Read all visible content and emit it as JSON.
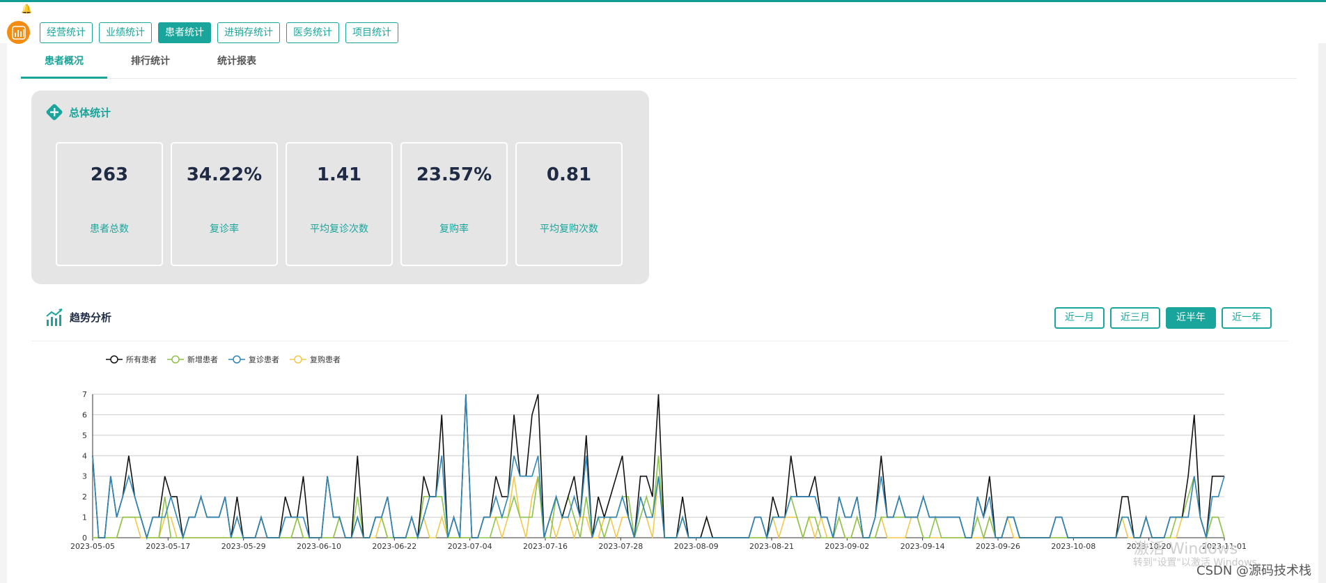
{
  "header": {
    "tabs": [
      "经营统计",
      "业绩统计",
      "患者统计",
      "进销存统计",
      "医务统计",
      "项目统计"
    ],
    "active_tab": 2
  },
  "subtabs": {
    "items": [
      "患者概况",
      "排行统计",
      "统计报表"
    ],
    "active": 0
  },
  "summary": {
    "title": "总体统计",
    "cards": [
      {
        "value": "263",
        "label": "患者总数"
      },
      {
        "value": "34.22%",
        "label": "复诊率"
      },
      {
        "value": "1.41",
        "label": "平均复诊次数"
      },
      {
        "value": "23.57%",
        "label": "复购率"
      },
      {
        "value": "0.81",
        "label": "平均复购次数"
      }
    ]
  },
  "trend": {
    "title": "趋势分析",
    "ranges": [
      "近一月",
      "近三月",
      "近半年",
      "近一年"
    ],
    "active_range": 2
  },
  "chart_data": {
    "type": "line",
    "ylim": [
      0,
      7
    ],
    "yticks": [
      0,
      1,
      2,
      3,
      4,
      5,
      6,
      7
    ],
    "xticks": [
      "2023-05-05",
      "2023-05-17",
      "2023-05-29",
      "2023-06-10",
      "2023-06-22",
      "2023-07-04",
      "2023-07-16",
      "2023-07-28",
      "2023-08-09",
      "2023-08-21",
      "2023-09-02",
      "2023-09-14",
      "2023-09-26",
      "2023-10-08",
      "2023-10-20",
      "2023-11-01"
    ],
    "legend_position": "top-left",
    "colors": [
      "#111111",
      "#8cc34a",
      "#2f86b5",
      "#f4c84a"
    ],
    "series": [
      {
        "name": "所有患者",
        "values": [
          4,
          0,
          0,
          3,
          1,
          2,
          4,
          2,
          1,
          0,
          1,
          1,
          3,
          2,
          2,
          0,
          1,
          1,
          2,
          1,
          1,
          1,
          2,
          0,
          2,
          0,
          0,
          0,
          1,
          0,
          0,
          0,
          2,
          1,
          1,
          3,
          0,
          0,
          0,
          3,
          1,
          1,
          0,
          0,
          4,
          0,
          0,
          1,
          1,
          2,
          0,
          0,
          0,
          1,
          0,
          3,
          2,
          2,
          6,
          0,
          1,
          0,
          7,
          0,
          0,
          1,
          1,
          3,
          2,
          2,
          6,
          3,
          3,
          6,
          7,
          0,
          1,
          2,
          1,
          2,
          3,
          1,
          5,
          0,
          2,
          1,
          2,
          3,
          4,
          1,
          0,
          3,
          3,
          2,
          7,
          0,
          0,
          0,
          2,
          0,
          0,
          0,
          1,
          0,
          0,
          0,
          0,
          0,
          0,
          0,
          1,
          1,
          0,
          2,
          1,
          1,
          4,
          2,
          2,
          2,
          3,
          1,
          1,
          0,
          2,
          1,
          1,
          2,
          0,
          0,
          1,
          4,
          1,
          1,
          2,
          1,
          1,
          1,
          2,
          1,
          1,
          1,
          1,
          1,
          1,
          0,
          0,
          2,
          1,
          3,
          0,
          0,
          1,
          1,
          0,
          0,
          0,
          0,
          0,
          0,
          1,
          1,
          0,
          0,
          0,
          0,
          0,
          0,
          0,
          0,
          0,
          2,
          2,
          0,
          0,
          1,
          0,
          0,
          0,
          1,
          1,
          1,
          3,
          6,
          1,
          0,
          3,
          3,
          3
        ]
      },
      {
        "name": "新增患者",
        "values": [
          0,
          0,
          0,
          0,
          0,
          1,
          1,
          1,
          1,
          0,
          0,
          0,
          2,
          0,
          0,
          0,
          0,
          0,
          0,
          0,
          0,
          0,
          0,
          0,
          0,
          0,
          0,
          0,
          1,
          0,
          0,
          0,
          0,
          0,
          1,
          0,
          0,
          0,
          0,
          0,
          0,
          1,
          0,
          0,
          2,
          0,
          0,
          1,
          1,
          0,
          0,
          0,
          0,
          0,
          0,
          2,
          2,
          2,
          2,
          0,
          0,
          0,
          0,
          0,
          0,
          0,
          0,
          1,
          1,
          1,
          2,
          1,
          1,
          1,
          3,
          0,
          0,
          2,
          1,
          2,
          1,
          0,
          2,
          0,
          1,
          0,
          1,
          1,
          2,
          2,
          0,
          1,
          2,
          1,
          4,
          0,
          0,
          0,
          1,
          0,
          0,
          0,
          1,
          0,
          0,
          0,
          0,
          0,
          0,
          0,
          0,
          0,
          0,
          1,
          1,
          1,
          2,
          1,
          0,
          1,
          1,
          0,
          0,
          0,
          1,
          0,
          0,
          1,
          0,
          0,
          0,
          1,
          1,
          1,
          1,
          1,
          1,
          1,
          0,
          0,
          1,
          0,
          0,
          0,
          0,
          0,
          0,
          1,
          0,
          1,
          0,
          0,
          1,
          1,
          0,
          0,
          0,
          0,
          0,
          0,
          0,
          0,
          0,
          0,
          0,
          0,
          0,
          0,
          0,
          0,
          0,
          1,
          1,
          0,
          0,
          1,
          0,
          0,
          0,
          0,
          1,
          1,
          2,
          3,
          1,
          0,
          1,
          1,
          0
        ]
      },
      {
        "name": "复诊患者",
        "values": [
          4,
          0,
          0,
          3,
          1,
          2,
          3,
          2,
          1,
          0,
          1,
          1,
          1,
          2,
          1,
          0,
          1,
          1,
          2,
          1,
          1,
          1,
          2,
          0,
          1,
          0,
          0,
          0,
          1,
          0,
          0,
          0,
          1,
          1,
          1,
          1,
          0,
          0,
          0,
          3,
          1,
          1,
          0,
          0,
          1,
          0,
          0,
          1,
          1,
          2,
          0,
          0,
          0,
          1,
          0,
          1,
          2,
          2,
          4,
          0,
          1,
          0,
          7,
          0,
          0,
          1,
          1,
          2,
          1,
          2,
          4,
          3,
          3,
          3,
          4,
          0,
          1,
          2,
          1,
          1,
          2,
          1,
          4,
          0,
          1,
          1,
          1,
          1,
          2,
          1,
          0,
          2,
          1,
          1,
          3,
          0,
          0,
          0,
          1,
          0,
          0,
          0,
          0,
          0,
          0,
          0,
          0,
          0,
          0,
          0,
          1,
          1,
          0,
          1,
          1,
          1,
          2,
          2,
          2,
          2,
          2,
          1,
          1,
          0,
          2,
          1,
          1,
          2,
          0,
          0,
          1,
          3,
          1,
          1,
          2,
          1,
          1,
          1,
          2,
          1,
          1,
          1,
          1,
          1,
          1,
          0,
          0,
          2,
          1,
          2,
          0,
          0,
          1,
          1,
          0,
          0,
          0,
          0,
          0,
          0,
          1,
          1,
          0,
          0,
          0,
          0,
          0,
          0,
          0,
          0,
          0,
          1,
          1,
          0,
          0,
          1,
          0,
          0,
          0,
          1,
          1,
          1,
          1,
          3,
          1,
          0,
          2,
          2,
          3
        ]
      },
      {
        "name": "复购患者",
        "values": [
          0,
          0,
          0,
          0,
          0,
          1,
          1,
          1,
          0,
          0,
          0,
          0,
          1,
          1,
          0,
          0,
          0,
          0,
          0,
          0,
          0,
          0,
          0,
          0,
          1,
          0,
          0,
          0,
          1,
          0,
          0,
          0,
          0,
          0,
          1,
          0,
          0,
          0,
          0,
          0,
          0,
          1,
          0,
          0,
          1,
          0,
          0,
          0,
          1,
          0,
          0,
          0,
          0,
          0,
          0,
          1,
          0,
          0,
          1,
          0,
          0,
          0,
          0,
          0,
          0,
          1,
          1,
          1,
          0,
          1,
          3,
          1,
          0,
          2,
          3,
          0,
          1,
          0,
          1,
          1,
          0,
          1,
          1,
          0,
          0,
          1,
          1,
          0,
          1,
          1,
          0,
          2,
          1,
          0,
          3,
          0,
          0,
          0,
          1,
          0,
          0,
          0,
          0,
          0,
          0,
          0,
          0,
          0,
          0,
          0,
          0,
          0,
          0,
          1,
          0,
          1,
          1,
          1,
          0,
          1,
          0,
          1,
          0,
          0,
          1,
          0,
          0,
          1,
          0,
          0,
          0,
          1,
          0,
          0,
          0,
          0,
          1,
          1,
          0,
          0,
          0,
          0,
          0,
          0,
          0,
          0,
          0,
          0,
          0,
          1,
          0,
          0,
          1,
          0,
          0,
          0,
          0,
          0,
          0,
          0,
          0,
          0,
          0,
          0,
          0,
          0,
          0,
          0,
          0,
          0,
          0,
          1,
          0,
          0,
          0,
          1,
          0,
          0,
          0,
          0,
          0,
          1,
          1,
          3,
          1,
          0,
          1,
          1,
          0
        ]
      }
    ]
  },
  "watermark": {
    "activate_title": "激活 Windows",
    "activate_hint": "转到\"设置\"以激活 Windows。",
    "source": "CSDN @源码技术栈"
  }
}
